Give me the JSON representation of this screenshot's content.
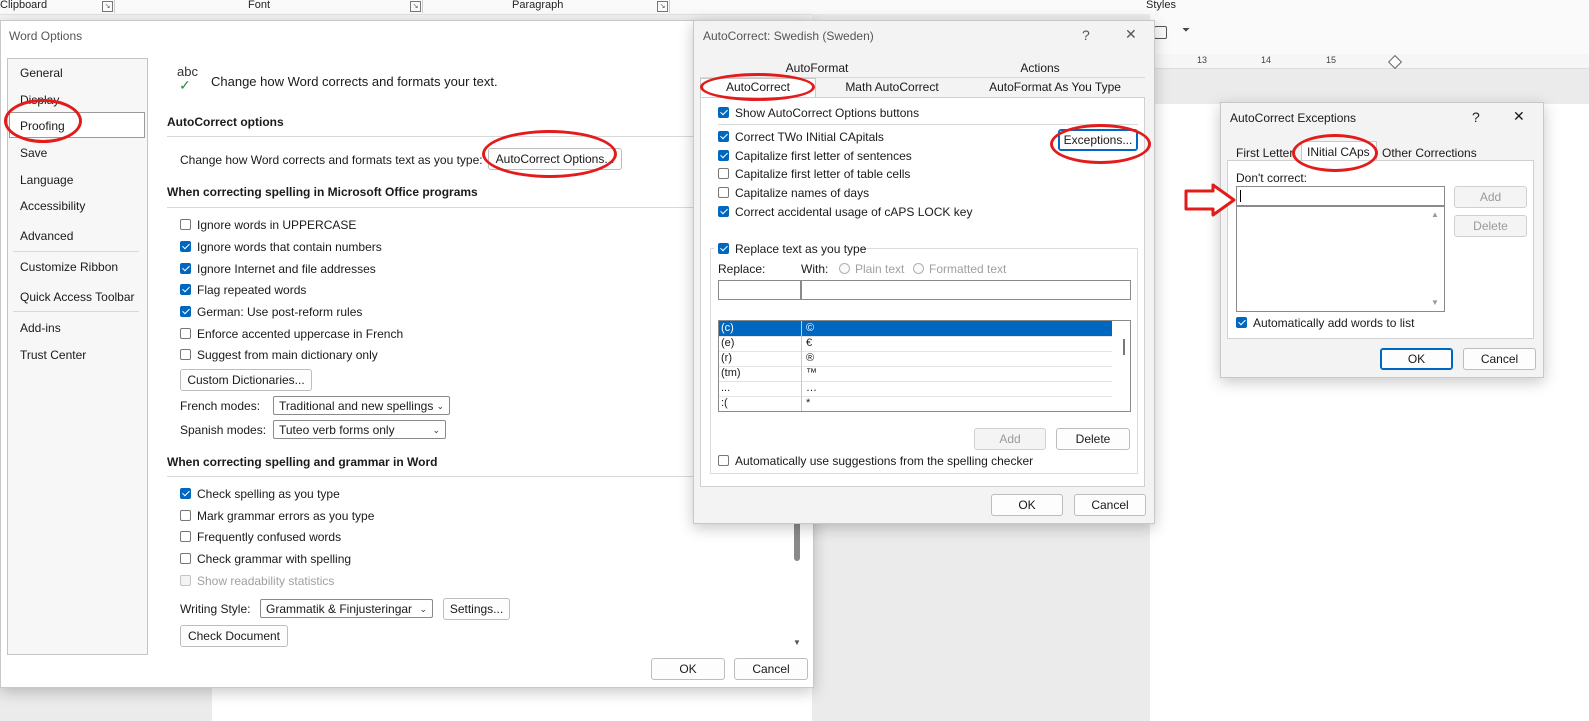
{
  "ribbon": {
    "groups": [
      "Clipboard",
      "Font",
      "Paragraph",
      "Styles"
    ]
  },
  "ruler": {
    "marks": [
      "13",
      "14",
      "15"
    ]
  },
  "word_options": {
    "title": "Word Options",
    "nav": [
      "General",
      "Display",
      "Proofing",
      "Save",
      "Language",
      "Accessibility",
      "Advanced",
      "Customize Ribbon",
      "Quick Access Toolbar",
      "Add-ins",
      "Trust Center"
    ],
    "selected_nav": "Proofing",
    "header_icon_text": "abc",
    "header_text": "Change how Word corrects and formats your text.",
    "autocorrect_section": "AutoCorrect options",
    "autocorrect_desc": "Change how Word corrects and formats text as you type:",
    "autocorrect_button": "AutoCorrect Options...",
    "office_section": "When correcting spelling in Microsoft Office programs",
    "office_options": [
      {
        "label": "Ignore words in UPPERCASE",
        "checked": false
      },
      {
        "label": "Ignore words that contain numbers",
        "checked": true
      },
      {
        "label": "Ignore Internet and file addresses",
        "checked": true
      },
      {
        "label": "Flag repeated words",
        "checked": true
      },
      {
        "label": "German: Use post-reform rules",
        "checked": true
      },
      {
        "label": "Enforce accented uppercase in French",
        "checked": false
      },
      {
        "label": "Suggest from main dictionary only",
        "checked": false
      }
    ],
    "custom_dict_button": "Custom Dictionaries...",
    "french_label": "French modes:",
    "french_value": "Traditional and new spellings",
    "spanish_label": "Spanish modes:",
    "spanish_value": "Tuteo verb forms only",
    "word_section": "When correcting spelling and grammar in Word",
    "word_options_list": [
      {
        "label": "Check spelling as you type",
        "checked": true
      },
      {
        "label": "Mark grammar errors as you type",
        "checked": false
      },
      {
        "label": "Frequently confused words",
        "checked": false
      },
      {
        "label": "Check grammar with spelling",
        "checked": false
      },
      {
        "label": "Show readability statistics",
        "checked": false
      }
    ],
    "writing_style_label": "Writing Style:",
    "writing_style_value": "Grammatik & Finjusteringar",
    "settings_button": "Settings...",
    "check_doc_button": "Check Document",
    "ok": "OK",
    "cancel": "Cancel"
  },
  "autocorrect": {
    "title": "AutoCorrect: Swedish (Sweden)",
    "help": "?",
    "close": "✕",
    "tabs_top": [
      "AutoFormat",
      "Actions"
    ],
    "tabs_bottom": [
      "AutoCorrect",
      "Math AutoCorrect",
      "AutoFormat As You Type"
    ],
    "show_buttons": {
      "label": "Show AutoCorrect Options buttons",
      "checked": true
    },
    "options": [
      {
        "label": "Correct TWo INitial CApitals",
        "checked": true
      },
      {
        "label": "Capitalize first letter of sentences",
        "checked": true
      },
      {
        "label": "Capitalize first letter of table cells",
        "checked": false
      },
      {
        "label": "Capitalize names of days",
        "checked": false
      },
      {
        "label": "Correct accidental usage of cAPS LOCK key",
        "checked": true
      }
    ],
    "exceptions_button": "Exceptions...",
    "replace_group": {
      "label": "Replace text as you type",
      "checked": true
    },
    "replace_label": "Replace:",
    "with_label": "With:",
    "plain_text": "Plain text",
    "formatted_text": "Formatted text",
    "rows": [
      {
        "from": "(c)",
        "to": "©"
      },
      {
        "from": "(e)",
        "to": "€"
      },
      {
        "from": "(r)",
        "to": "®"
      },
      {
        "from": "(tm)",
        "to": "™"
      },
      {
        "from": "...",
        "to": "…"
      },
      {
        "from": ":(",
        "to": "*"
      }
    ],
    "add": "Add",
    "delete": "Delete",
    "auto_suggest": {
      "label": "Automatically use suggestions from the spelling checker",
      "checked": false
    },
    "ok": "OK",
    "cancel": "Cancel"
  },
  "exceptions": {
    "title": "AutoCorrect Exceptions",
    "help": "?",
    "close": "✕",
    "tabs": [
      "First Letter",
      "INitial CAps",
      "Other Corrections"
    ],
    "dont_correct_label": "Don't correct:",
    "input_value": "",
    "add": "Add",
    "delete": "Delete",
    "auto_add": {
      "label": "Automatically add words to list",
      "checked": true
    },
    "ok": "OK",
    "cancel": "Cancel"
  },
  "colors": {
    "accent": "#0067c0",
    "annotation": "#e21b1b"
  }
}
